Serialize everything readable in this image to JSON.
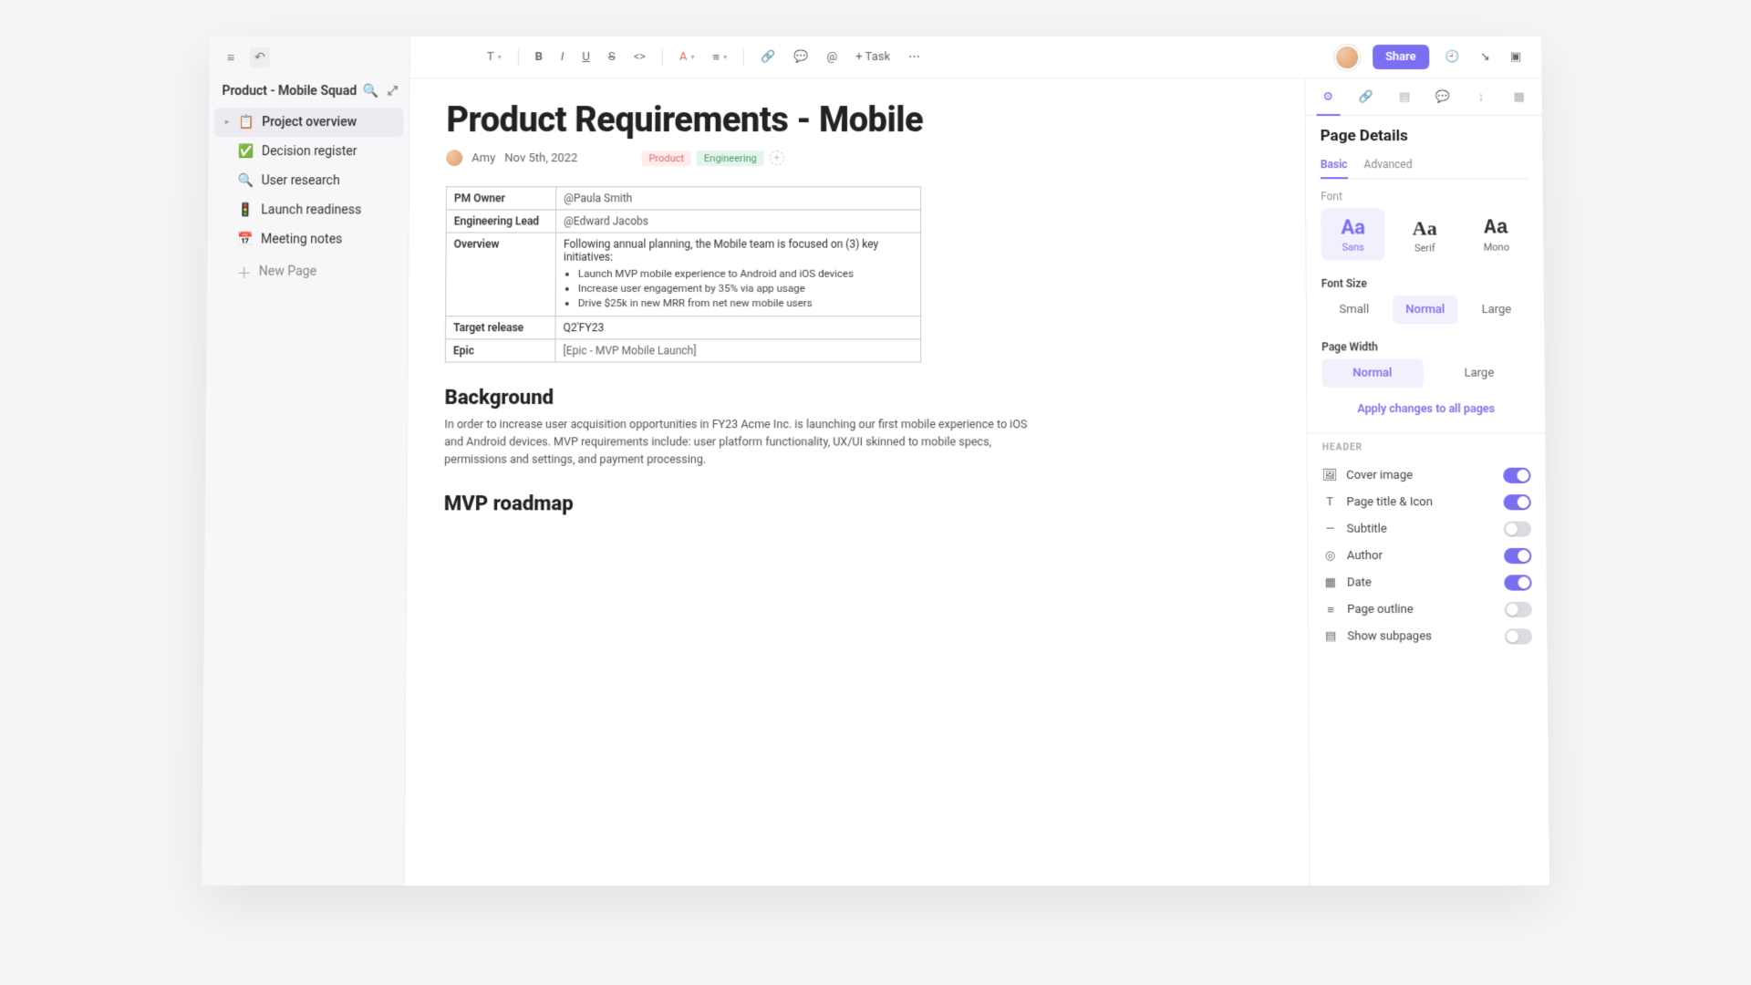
{
  "topbar": {
    "share_label": "Share",
    "task_label": "+ Task"
  },
  "sidebar": {
    "workspace": "Product - Mobile Squad",
    "items": [
      {
        "icon": "📋",
        "label": "Project overview",
        "active": true,
        "caret": true
      },
      {
        "icon": "✅",
        "label": "Decision register"
      },
      {
        "icon": "🔍",
        "label": "User research"
      },
      {
        "icon": "🚦",
        "label": "Launch readiness"
      },
      {
        "icon": "📅",
        "label": "Meeting notes"
      }
    ],
    "new_page": "New Page"
  },
  "doc": {
    "title": "Product Requirements - Mobile",
    "author": "Amy",
    "date": "Nov 5th, 2022",
    "tags": {
      "product": "Product",
      "engineering": "Engineering"
    },
    "table": {
      "pm_owner_label": "PM Owner",
      "pm_owner_value": "@Paula Smith",
      "eng_lead_label": "Engineering Lead",
      "eng_lead_value": "@Edward Jacobs",
      "overview_label": "Overview",
      "overview_intro": "Following annual planning, the Mobile team is focused on (3) key initiatives:",
      "overview_bullets": [
        "Launch MVP mobile experience to Android and iOS devices",
        "Increase user engagement by 35% via app usage",
        "Drive $25k in new MRR from net new mobile users"
      ],
      "target_label": "Target release",
      "target_value": "Q2'FY23",
      "epic_label": "Epic",
      "epic_value": "[Epic - MVP Mobile Launch]"
    },
    "background_heading": "Background",
    "background_body": "In order to increase user acquisition opportunities in FY23 Acme Inc. is launching our first mobile experience to iOS and Android devices. MVP requirements include: user platform functionality, UX/UI skinned to mobile specs, permissions and settings, and payment processing.",
    "roadmap_heading": "MVP roadmap"
  },
  "panel": {
    "title": "Page Details",
    "tab_basic": "Basic",
    "tab_advanced": "Advanced",
    "font_label": "Font",
    "font_sans": "Sans",
    "font_serif": "Serif",
    "font_mono": "Mono",
    "font_size_label": "Font Size",
    "size_small": "Small",
    "size_normal": "Normal",
    "size_large": "Large",
    "page_width_label": "Page Width",
    "width_normal": "Normal",
    "width_large": "Large",
    "apply_all": "Apply changes to all pages",
    "header_label": "HEADER",
    "rows": {
      "cover": "Cover image",
      "title_icon": "Page title & Icon",
      "subtitle": "Subtitle",
      "author": "Author",
      "date": "Date",
      "outline": "Page outline",
      "subpages": "Show subpages"
    }
  }
}
